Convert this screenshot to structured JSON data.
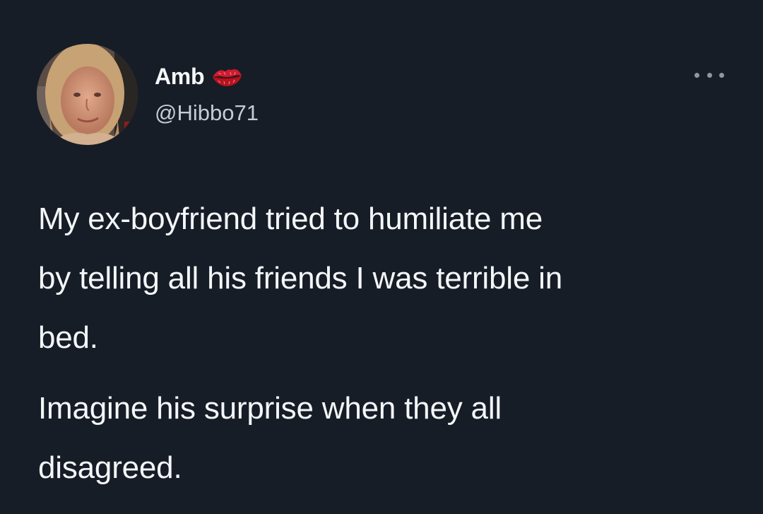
{
  "author": {
    "display_name": "Amb",
    "handle": "@Hibbo71",
    "badge_icon": "lips-emoji-icon",
    "avatar_icon": "profile-photo-avatar"
  },
  "tweet": {
    "paragraph_1": "My ex-boyfriend tried to humiliate me\nby telling all his friends I was terrible in\nbed.",
    "paragraph_2": "Imagine his surprise when they all\ndisagreed."
  },
  "menu": {
    "icon": "more-options-icon"
  },
  "colors": {
    "background": "#161d27",
    "text": "#f4f6f8",
    "handle": "#c5ccd3",
    "dots": "#8f98a2",
    "lips": "#d01c2e"
  }
}
